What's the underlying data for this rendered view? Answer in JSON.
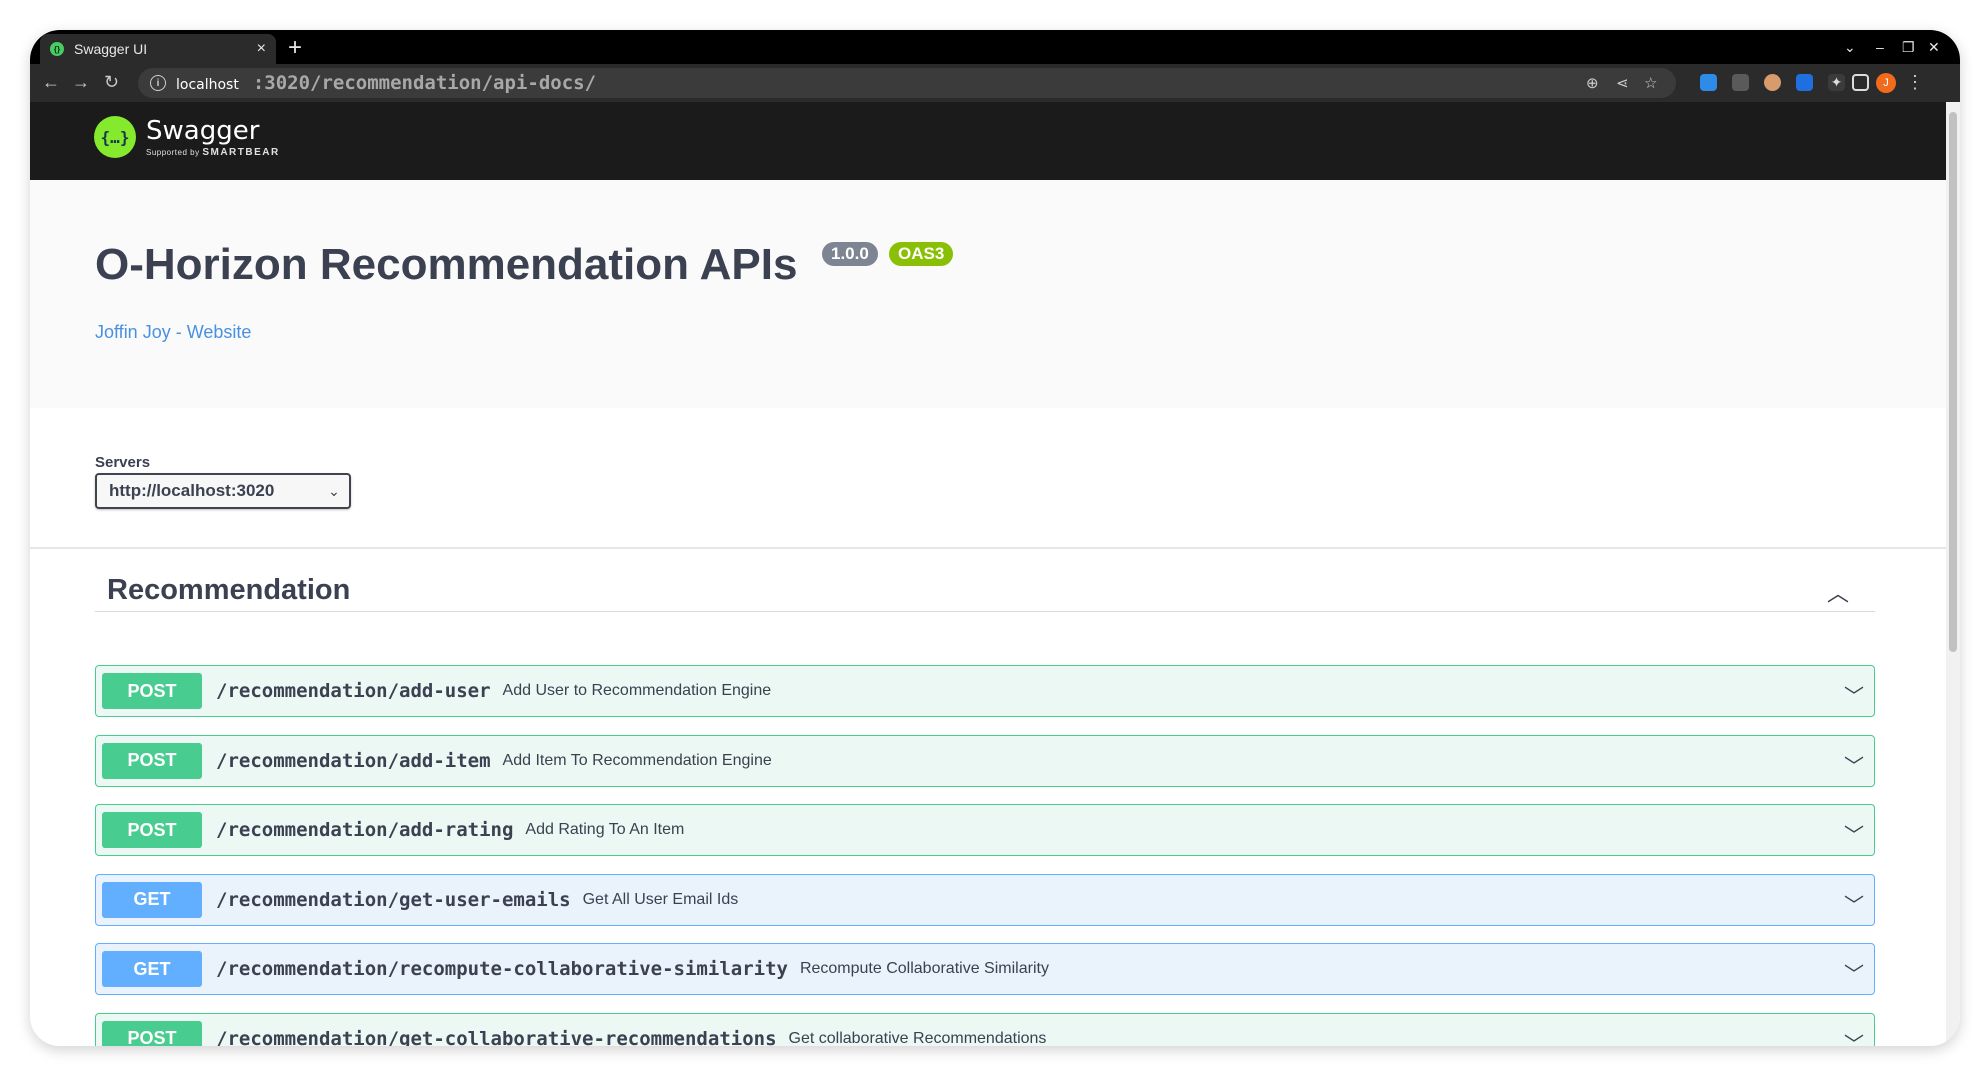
{
  "browser": {
    "tab_title": "Swagger UI",
    "tab_close": "×",
    "new_tab": "+",
    "url_host": "localhost",
    "url_rest": ":3020/recommendation/api-docs/",
    "avatar_initial": "J"
  },
  "swagger": {
    "logo_name": "Swagger",
    "logo_sub_prefix": "Supported by",
    "logo_sub_brand": "SMARTBEAR"
  },
  "info": {
    "title": "O-Horizon Recommendation APIs",
    "version_badge": "1.0.0",
    "oas_badge": "OAS3",
    "contact_link": "Joffin Joy - Website"
  },
  "servers": {
    "label": "Servers",
    "selected": "http://localhost:3020"
  },
  "tag": {
    "name": "Recommendation"
  },
  "operations": [
    {
      "method": "POST",
      "path": "/recommendation/add-user",
      "summary": "Add User to Recommendation Engine"
    },
    {
      "method": "POST",
      "path": "/recommendation/add-item",
      "summary": "Add Item To Recommendation Engine"
    },
    {
      "method": "POST",
      "path": "/recommendation/add-rating",
      "summary": "Add Rating To An Item"
    },
    {
      "method": "GET",
      "path": "/recommendation/get-user-emails",
      "summary": "Get All User Email Ids"
    },
    {
      "method": "GET",
      "path": "/recommendation/recompute-collaborative-similarity",
      "summary": "Recompute Collaborative Similarity"
    },
    {
      "method": "POST",
      "path": "/recommendation/get-collaborative-recommendations",
      "summary": "Get collaborative Recommendations"
    }
  ],
  "colors": {
    "post": "#49cc90",
    "get": "#61affe",
    "swagger_green": "#85ea2d"
  }
}
